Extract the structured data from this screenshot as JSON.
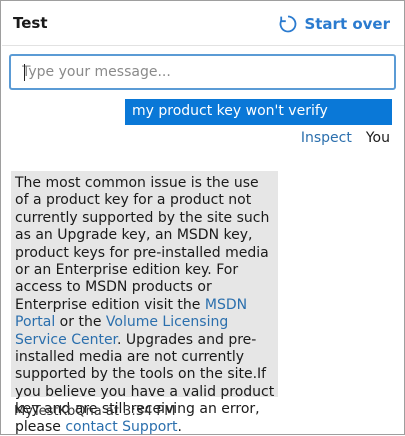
{
  "header": {
    "title": "Test",
    "start_over_label": "Start over"
  },
  "composer": {
    "placeholder": "Type your message..."
  },
  "user_message": {
    "text": "my product key won't verify",
    "inspect_label": "Inspect",
    "sender_label": "You"
  },
  "bot_message": {
    "text_1": "The most common issue is the use of a product key for a product not currently supported by the site such as an Upgrade key, an MSDN key, product keys for pre-installed media or an Enterprise edition key. For access to MSDN products or Enterprise edition visit the ",
    "link_msdn": "MSDN Portal",
    "text_2": " or the ",
    "link_vlsc": "Volume Licensing Service Center",
    "text_3": ". Upgrades and pre-installed media are not currently supported by the tools on the site.If you believe you have a valid product key and are still receiving an error, please ",
    "link_support": "contact Support",
    "text_4": ".",
    "meta": "MyTestKbQna at 3:34 PM"
  },
  "colors": {
    "accent": "#2b7bcf",
    "user_bubble": "#0a78d7",
    "bot_bubble": "#e6e6e6",
    "link": "#2b6fad",
    "input_border": "#5b9bd5"
  },
  "icons": {
    "start_over": "refresh-icon"
  }
}
